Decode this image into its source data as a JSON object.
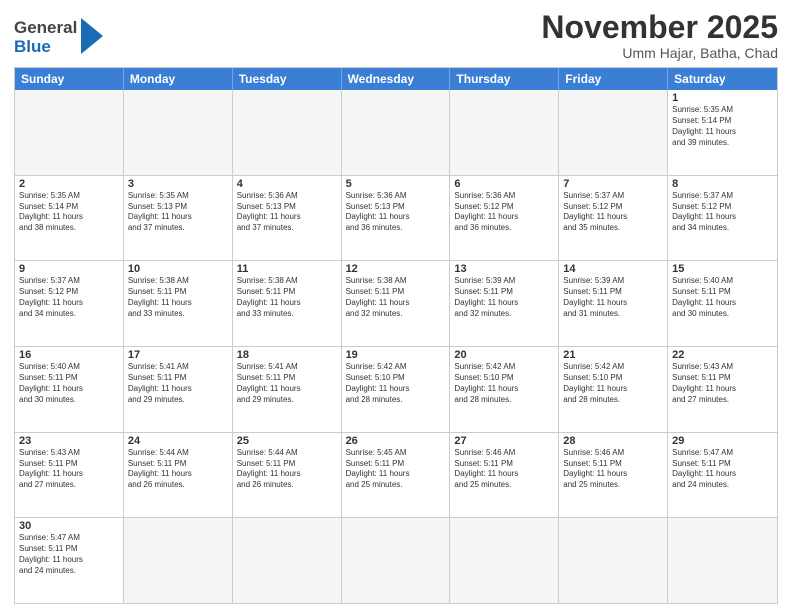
{
  "header": {
    "logo_general": "General",
    "logo_blue": "Blue",
    "month_title": "November 2025",
    "location": "Umm Hajar, Batha, Chad"
  },
  "day_headers": [
    "Sunday",
    "Monday",
    "Tuesday",
    "Wednesday",
    "Thursday",
    "Friday",
    "Saturday"
  ],
  "weeks": [
    [
      {
        "num": "",
        "info": "",
        "empty": true
      },
      {
        "num": "",
        "info": "",
        "empty": true
      },
      {
        "num": "",
        "info": "",
        "empty": true
      },
      {
        "num": "",
        "info": "",
        "empty": true
      },
      {
        "num": "",
        "info": "",
        "empty": true
      },
      {
        "num": "",
        "info": "",
        "empty": true
      },
      {
        "num": "1",
        "info": "Sunrise: 5:35 AM\nSunset: 5:14 PM\nDaylight: 11 hours\nand 39 minutes.",
        "empty": false
      }
    ],
    [
      {
        "num": "2",
        "info": "Sunrise: 5:35 AM\nSunset: 5:14 PM\nDaylight: 11 hours\nand 38 minutes.",
        "empty": false
      },
      {
        "num": "3",
        "info": "Sunrise: 5:35 AM\nSunset: 5:13 PM\nDaylight: 11 hours\nand 37 minutes.",
        "empty": false
      },
      {
        "num": "4",
        "info": "Sunrise: 5:36 AM\nSunset: 5:13 PM\nDaylight: 11 hours\nand 37 minutes.",
        "empty": false
      },
      {
        "num": "5",
        "info": "Sunrise: 5:36 AM\nSunset: 5:13 PM\nDaylight: 11 hours\nand 36 minutes.",
        "empty": false
      },
      {
        "num": "6",
        "info": "Sunrise: 5:36 AM\nSunset: 5:12 PM\nDaylight: 11 hours\nand 36 minutes.",
        "empty": false
      },
      {
        "num": "7",
        "info": "Sunrise: 5:37 AM\nSunset: 5:12 PM\nDaylight: 11 hours\nand 35 minutes.",
        "empty": false
      },
      {
        "num": "8",
        "info": "Sunrise: 5:37 AM\nSunset: 5:12 PM\nDaylight: 11 hours\nand 34 minutes.",
        "empty": false
      }
    ],
    [
      {
        "num": "9",
        "info": "Sunrise: 5:37 AM\nSunset: 5:12 PM\nDaylight: 11 hours\nand 34 minutes.",
        "empty": false
      },
      {
        "num": "10",
        "info": "Sunrise: 5:38 AM\nSunset: 5:11 PM\nDaylight: 11 hours\nand 33 minutes.",
        "empty": false
      },
      {
        "num": "11",
        "info": "Sunrise: 5:38 AM\nSunset: 5:11 PM\nDaylight: 11 hours\nand 33 minutes.",
        "empty": false
      },
      {
        "num": "12",
        "info": "Sunrise: 5:38 AM\nSunset: 5:11 PM\nDaylight: 11 hours\nand 32 minutes.",
        "empty": false
      },
      {
        "num": "13",
        "info": "Sunrise: 5:39 AM\nSunset: 5:11 PM\nDaylight: 11 hours\nand 32 minutes.",
        "empty": false
      },
      {
        "num": "14",
        "info": "Sunrise: 5:39 AM\nSunset: 5:11 PM\nDaylight: 11 hours\nand 31 minutes.",
        "empty": false
      },
      {
        "num": "15",
        "info": "Sunrise: 5:40 AM\nSunset: 5:11 PM\nDaylight: 11 hours\nand 30 minutes.",
        "empty": false
      }
    ],
    [
      {
        "num": "16",
        "info": "Sunrise: 5:40 AM\nSunset: 5:11 PM\nDaylight: 11 hours\nand 30 minutes.",
        "empty": false
      },
      {
        "num": "17",
        "info": "Sunrise: 5:41 AM\nSunset: 5:11 PM\nDaylight: 11 hours\nand 29 minutes.",
        "empty": false
      },
      {
        "num": "18",
        "info": "Sunrise: 5:41 AM\nSunset: 5:11 PM\nDaylight: 11 hours\nand 29 minutes.",
        "empty": false
      },
      {
        "num": "19",
        "info": "Sunrise: 5:42 AM\nSunset: 5:10 PM\nDaylight: 11 hours\nand 28 minutes.",
        "empty": false
      },
      {
        "num": "20",
        "info": "Sunrise: 5:42 AM\nSunset: 5:10 PM\nDaylight: 11 hours\nand 28 minutes.",
        "empty": false
      },
      {
        "num": "21",
        "info": "Sunrise: 5:42 AM\nSunset: 5:10 PM\nDaylight: 11 hours\nand 28 minutes.",
        "empty": false
      },
      {
        "num": "22",
        "info": "Sunrise: 5:43 AM\nSunset: 5:11 PM\nDaylight: 11 hours\nand 27 minutes.",
        "empty": false
      }
    ],
    [
      {
        "num": "23",
        "info": "Sunrise: 5:43 AM\nSunset: 5:11 PM\nDaylight: 11 hours\nand 27 minutes.",
        "empty": false
      },
      {
        "num": "24",
        "info": "Sunrise: 5:44 AM\nSunset: 5:11 PM\nDaylight: 11 hours\nand 26 minutes.",
        "empty": false
      },
      {
        "num": "25",
        "info": "Sunrise: 5:44 AM\nSunset: 5:11 PM\nDaylight: 11 hours\nand 26 minutes.",
        "empty": false
      },
      {
        "num": "26",
        "info": "Sunrise: 5:45 AM\nSunset: 5:11 PM\nDaylight: 11 hours\nand 25 minutes.",
        "empty": false
      },
      {
        "num": "27",
        "info": "Sunrise: 5:46 AM\nSunset: 5:11 PM\nDaylight: 11 hours\nand 25 minutes.",
        "empty": false
      },
      {
        "num": "28",
        "info": "Sunrise: 5:46 AM\nSunset: 5:11 PM\nDaylight: 11 hours\nand 25 minutes.",
        "empty": false
      },
      {
        "num": "29",
        "info": "Sunrise: 5:47 AM\nSunset: 5:11 PM\nDaylight: 11 hours\nand 24 minutes.",
        "empty": false
      }
    ],
    [
      {
        "num": "30",
        "info": "Sunrise: 5:47 AM\nSunset: 5:11 PM\nDaylight: 11 hours\nand 24 minutes.",
        "empty": false
      },
      {
        "num": "",
        "info": "",
        "empty": true
      },
      {
        "num": "",
        "info": "",
        "empty": true
      },
      {
        "num": "",
        "info": "",
        "empty": true
      },
      {
        "num": "",
        "info": "",
        "empty": true
      },
      {
        "num": "",
        "info": "",
        "empty": true
      },
      {
        "num": "",
        "info": "",
        "empty": true
      }
    ]
  ]
}
